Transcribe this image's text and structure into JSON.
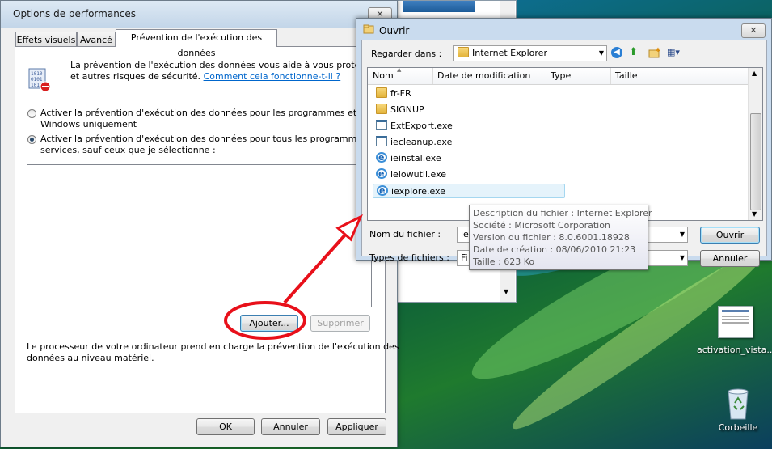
{
  "perf_window": {
    "title": "Options de performances",
    "close_label": "✕",
    "tabs": [
      "Effets visuels",
      "Avancé",
      "Prévention de l'exécution des données"
    ],
    "intro_line1": "La prévention de l'exécution des données vous aide à vous protéger des v",
    "intro_line2": "et autres risques de sécurité.",
    "intro_link": "Comment cela fonctionne-t-il ?",
    "radio1_line1": "Activer la prévention d'exécution des données pour les programmes et les service",
    "radio1_line2": "Windows uniquement",
    "radio2_line1": "Activer la prévention d'exécution des données pour tous les programmes et les",
    "radio2_line2": "services, sauf ceux que je sélectionne :",
    "add_button": "Ajouter...",
    "remove_button": "Supprimer",
    "footer_line1": "Le processeur de votre ordinateur prend en charge la prévention de l'exécution des",
    "footer_line2": "données au niveau matériel.",
    "ok_button": "OK",
    "cancel_button": "Annuler",
    "apply_button": "Appliquer"
  },
  "open_dialog": {
    "title": "Ouvrir",
    "close_label": "✕",
    "lookin_label": "Regarder dans :",
    "lookin_value": "Internet Explorer",
    "columns": [
      "Nom",
      "Date de modification",
      "Type",
      "Taille"
    ],
    "files": [
      {
        "name": "fr-FR",
        "icon": "folder"
      },
      {
        "name": "SIGNUP",
        "icon": "folder"
      },
      {
        "name": "ExtExport.exe",
        "icon": "exe"
      },
      {
        "name": "iecleanup.exe",
        "icon": "exe"
      },
      {
        "name": "ieinstal.exe",
        "icon": "ie"
      },
      {
        "name": "ielowutil.exe",
        "icon": "ie"
      },
      {
        "name": "iexplore.exe",
        "icon": "ie"
      }
    ],
    "filename_label": "Nom du fichier :",
    "filename_value": "iex",
    "filetype_label": "Types de fichiers :",
    "filetype_value": "Fi",
    "open_button": "Ouvrir",
    "cancel_button": "Annuler"
  },
  "tooltip": [
    "Description du fichier : Internet Explorer",
    "Société : Microsoft Corporation",
    "Version du fichier : 8.0.6001.18928",
    "Date de création : 08/06/2010 21:23",
    "Taille : 623 Ko"
  ],
  "desktop": {
    "icon1_label": "activation_vista...",
    "icon2_label": "Corbeille"
  },
  "colors": {
    "annotation_red": "#e8101a",
    "selection": "#cce8ff",
    "link": "#0066cc"
  }
}
